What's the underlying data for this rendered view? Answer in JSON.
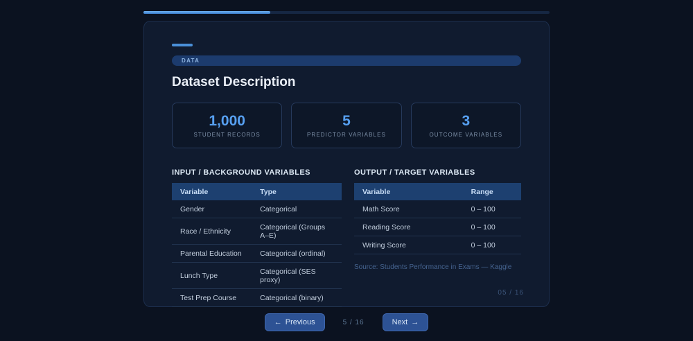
{
  "progress": {
    "percent": 31.25
  },
  "slide": {
    "badge": "DATA",
    "title": "Dataset Description",
    "stats": [
      {
        "value": "1,000",
        "label": "STUDENT RECORDS"
      },
      {
        "value": "5",
        "label": "PREDICTOR VARIABLES"
      },
      {
        "value": "3",
        "label": "OUTCOME VARIABLES"
      }
    ],
    "input_table": {
      "title": "INPUT / BACKGROUND VARIABLES",
      "columns": [
        "Variable",
        "Type"
      ],
      "rows": [
        [
          "Gender",
          "Categorical"
        ],
        [
          "Race / Ethnicity",
          "Categorical (Groups A–E)"
        ],
        [
          "Parental Education",
          "Categorical (ordinal)"
        ],
        [
          "Lunch Type",
          "Categorical (SES proxy)"
        ],
        [
          "Test Prep Course",
          "Categorical (binary)"
        ]
      ]
    },
    "output_table": {
      "title": "OUTPUT / TARGET VARIABLES",
      "columns": [
        "Variable",
        "Range"
      ],
      "rows": [
        [
          "Math Score",
          "0 – 100"
        ],
        [
          "Reading Score",
          "0 – 100"
        ],
        [
          "Writing Score",
          "0 – 100"
        ]
      ]
    },
    "source": "Source: Students Performance in Exams — Kaggle",
    "page_indicator": "05 / 16"
  },
  "nav": {
    "previous": {
      "icon": "←",
      "label": "Previous"
    },
    "counter": "5 / 16",
    "next": {
      "label": "Next",
      "icon": "→"
    }
  },
  "colors": {
    "page_bg": "#0b1220",
    "card_bg": "#101b2f",
    "accent_blue": "#4a90d9",
    "stat_value_blue": "#57a0f1",
    "table_header_bg": "#1d4070",
    "button_bg": "#2d5294"
  }
}
